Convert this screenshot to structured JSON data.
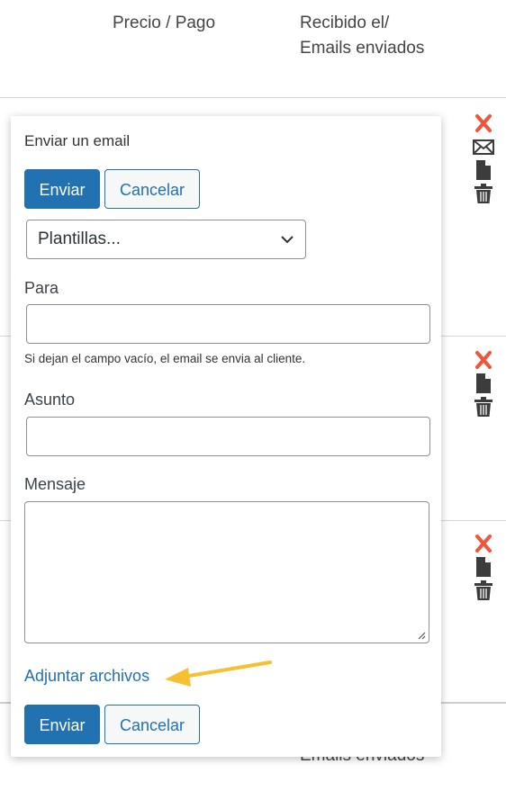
{
  "table": {
    "headers": {
      "price": "Precio / Pago",
      "received_line1": "Recibido el/",
      "received_line2": "Emails enviados"
    },
    "footer_header": "Emails enviados"
  },
  "popup": {
    "title": "Enviar un email",
    "send_label": "Enviar",
    "cancel_label": "Cancelar",
    "template_select": {
      "selected": "Plantillas..."
    },
    "to": {
      "label": "Para",
      "value": ""
    },
    "hint": "Si dejan el campo vacío, el email se envia al cliente.",
    "subject": {
      "label": "Asunto",
      "value": ""
    },
    "message": {
      "label": "Mensaje",
      "value": ""
    },
    "attach_link": "Adjuntar archivos"
  },
  "icons": {
    "delete_color": "#f0563b",
    "doc_color": "#3c3c3c",
    "annotation_color": "#f5c133"
  }
}
